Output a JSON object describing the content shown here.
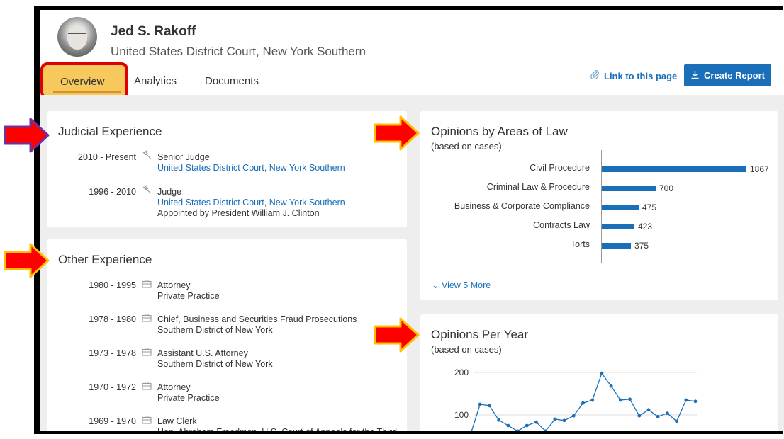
{
  "header": {
    "judge_name": "Jed S. Rakoff",
    "court": "United States District Court, New York Southern"
  },
  "tabs": [
    {
      "label": "Overview",
      "active": true
    },
    {
      "label": "Analytics",
      "active": false
    },
    {
      "label": "Documents",
      "active": false
    }
  ],
  "actions": {
    "link_label": "Link to this page",
    "report_label": "Create Report"
  },
  "judicial": {
    "title": "Judicial Experience",
    "items": [
      {
        "dates": "2010 - Present",
        "role": "Senior Judge",
        "court": "United States District Court, New York Southern",
        "note": ""
      },
      {
        "dates": "1996 - 2010",
        "role": "Judge",
        "court": "United States District Court, New York Southern",
        "note": "Appointed by President William J. Clinton"
      }
    ]
  },
  "other": {
    "title": "Other Experience",
    "items": [
      {
        "dates": "1980 - 1995",
        "role": "Attorney",
        "org": "Private Practice"
      },
      {
        "dates": "1978 - 1980",
        "role": "Chief, Business and Securities Fraud Prosecutions",
        "org": "Southern District of New York"
      },
      {
        "dates": "1973 - 1978",
        "role": "Assistant U.S. Attorney",
        "org": "Southern District of New York"
      },
      {
        "dates": "1970 - 1972",
        "role": "Attorney",
        "org": "Private Practice"
      },
      {
        "dates": "1969 - 1970",
        "role": "Law Clerk",
        "org": "Hon. Abraham Freedman, U.S. Court of Appeals for the Third"
      }
    ]
  },
  "areas": {
    "title": "Opinions by Areas of Law",
    "subtitle": "(based on cases)",
    "view_more": "View 5 More"
  },
  "peryear": {
    "title": "Opinions Per Year",
    "subtitle": "(based on cases)"
  },
  "colors": {
    "accent": "#1a6fb8",
    "highlight_border": "#e00000",
    "highlight_fill": "#f7c95c",
    "arrow_fill": "#ff0000",
    "arrow_stroke": "#ffc000",
    "arrow_stroke_alt": "#7030a0"
  },
  "chart_data": [
    {
      "type": "bar",
      "orientation": "horizontal",
      "categories": [
        "Civil Procedure",
        "Criminal Law & Procedure",
        "Business & Corporate Compliance",
        "Contracts Law",
        "Torts"
      ],
      "values": [
        1867,
        700,
        475,
        423,
        375
      ]
    },
    {
      "type": "line",
      "yticks": [
        100,
        200
      ],
      "ylim": [
        60,
        210
      ],
      "values": [
        55,
        125,
        122,
        88,
        75,
        62,
        75,
        83,
        62,
        90,
        87,
        98,
        128,
        135,
        198,
        168,
        135,
        137,
        98,
        112,
        96,
        104,
        85,
        135,
        132
      ],
      "grid": true
    }
  ]
}
